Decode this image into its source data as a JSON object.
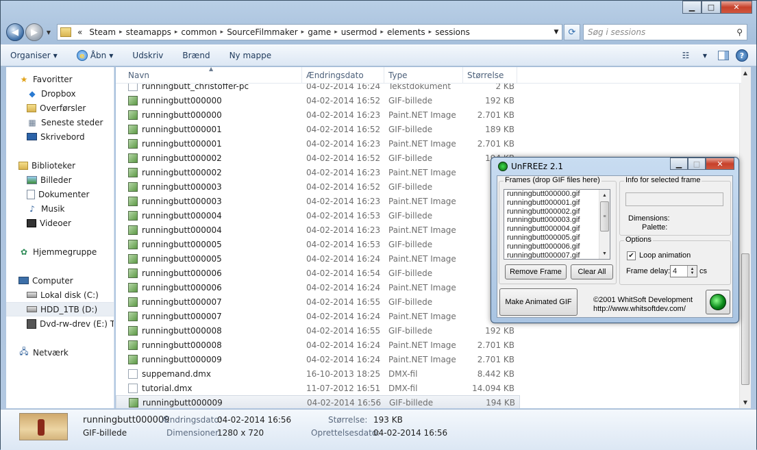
{
  "addressbar": {
    "overflow": "«",
    "crumbs": [
      "Steam",
      "steamapps",
      "common",
      "SourceFilmmaker",
      "game",
      "usermod",
      "elements",
      "sessions"
    ],
    "search_placeholder": "Søg i sessions"
  },
  "toolbar": {
    "organize": "Organiser",
    "open": "Åbn",
    "print": "Udskriv",
    "burn": "Brænd",
    "new_folder": "Ny mappe"
  },
  "sidebar": {
    "favorites": "Favoritter",
    "dropbox": "Dropbox",
    "downloads": "Overførsler",
    "recent": "Seneste steder",
    "desktop": "Skrivebord",
    "libraries": "Biblioteker",
    "pictures": "Billeder",
    "documents": "Dokumenter",
    "music": "Musik",
    "videos": "Videoer",
    "homegroup": "Hjemmegruppe",
    "computer": "Computer",
    "disk_c": "Lokal disk (C:)",
    "disk_d": "HDD_1TB (D:)",
    "disk_e": "Dvd-rw-drev (E:) The",
    "network": "Netværk"
  },
  "columns": {
    "name": "Navn",
    "date": "Ændringsdato",
    "type": "Type",
    "size": "Størrelse"
  },
  "files": [
    {
      "name": "runningbutt_christoffer-pc",
      "date": "04-02-2014 16:24",
      "type": "Tekstdokument",
      "size": "2 KB",
      "icon": "doc"
    },
    {
      "name": "runningbutt000000",
      "date": "04-02-2014 16:52",
      "type": "GIF-billede",
      "size": "192 KB",
      "icon": "gif"
    },
    {
      "name": "runningbutt000000",
      "date": "04-02-2014 16:23",
      "type": "Paint.NET Image",
      "size": "2.701 KB",
      "icon": "gif"
    },
    {
      "name": "runningbutt000001",
      "date": "04-02-2014 16:52",
      "type": "GIF-billede",
      "size": "189 KB",
      "icon": "gif"
    },
    {
      "name": "runningbutt000001",
      "date": "04-02-2014 16:23",
      "type": "Paint.NET Image",
      "size": "2.701 KB",
      "icon": "gif"
    },
    {
      "name": "runningbutt000002",
      "date": "04-02-2014 16:52",
      "type": "GIF-billede",
      "size": "194 KB",
      "icon": "gif"
    },
    {
      "name": "runningbutt000002",
      "date": "04-02-2014 16:23",
      "type": "Paint.NET Image",
      "size": "",
      "icon": "gif"
    },
    {
      "name": "runningbutt000003",
      "date": "04-02-2014 16:52",
      "type": "GIF-billede",
      "size": "",
      "icon": "gif"
    },
    {
      "name": "runningbutt000003",
      "date": "04-02-2014 16:23",
      "type": "Paint.NET Image",
      "size": "",
      "icon": "gif"
    },
    {
      "name": "runningbutt000004",
      "date": "04-02-2014 16:53",
      "type": "GIF-billede",
      "size": "",
      "icon": "gif"
    },
    {
      "name": "runningbutt000004",
      "date": "04-02-2014 16:23",
      "type": "Paint.NET Image",
      "size": "",
      "icon": "gif"
    },
    {
      "name": "runningbutt000005",
      "date": "04-02-2014 16:53",
      "type": "GIF-billede",
      "size": "",
      "icon": "gif"
    },
    {
      "name": "runningbutt000005",
      "date": "04-02-2014 16:24",
      "type": "Paint.NET Image",
      "size": "",
      "icon": "gif"
    },
    {
      "name": "runningbutt000006",
      "date": "04-02-2014 16:54",
      "type": "GIF-billede",
      "size": "",
      "icon": "gif"
    },
    {
      "name": "runningbutt000006",
      "date": "04-02-2014 16:24",
      "type": "Paint.NET Image",
      "size": "",
      "icon": "gif"
    },
    {
      "name": "runningbutt000007",
      "date": "04-02-2014 16:55",
      "type": "GIF-billede",
      "size": "",
      "icon": "gif"
    },
    {
      "name": "runningbutt000007",
      "date": "04-02-2014 16:24",
      "type": "Paint.NET Image",
      "size": "",
      "icon": "gif"
    },
    {
      "name": "runningbutt000008",
      "date": "04-02-2014 16:55",
      "type": "GIF-billede",
      "size": "192 KB",
      "icon": "gif"
    },
    {
      "name": "runningbutt000008",
      "date": "04-02-2014 16:24",
      "type": "Paint.NET Image",
      "size": "2.701 KB",
      "icon": "gif"
    },
    {
      "name": "runningbutt000009",
      "date": "04-02-2014 16:24",
      "type": "Paint.NET Image",
      "size": "2.701 KB",
      "icon": "gif"
    },
    {
      "name": "suppemand.dmx",
      "date": "16-10-2013 18:25",
      "type": "DMX-fil",
      "size": "8.442 KB",
      "icon": "doc"
    },
    {
      "name": "tutorial.dmx",
      "date": "11-07-2012 16:51",
      "type": "DMX-fil",
      "size": "14.094 KB",
      "icon": "doc"
    },
    {
      "name": "runningbutt000009",
      "date": "04-02-2014 16:56",
      "type": "GIF-billede",
      "size": "194 KB",
      "icon": "gif"
    }
  ],
  "selected_index": 22,
  "details": {
    "name": "runningbutt000009",
    "type": "GIF-billede",
    "modified_label": "Ændringsdato:",
    "modified": "04-02-2014 16:56",
    "dimensions_label": "Dimensioner:",
    "dimensions": "1280 x 720",
    "size_label": "Størrelse:",
    "size": "193 KB",
    "created_label": "Oprettelsesdato:",
    "created": "04-02-2014 16:56"
  },
  "unfreez": {
    "title": "UnFREEz 2.1",
    "frames_group": "Frames (drop GIF files here)",
    "frames": [
      "runningbutt000000.gif",
      "runningbutt000001.gif",
      "runningbutt000002.gif",
      "runningbutt000003.gif",
      "runningbutt000004.gif",
      "runningbutt000005.gif",
      "runningbutt000006.gif",
      "runningbutt000007.gif"
    ],
    "remove_frame": "Remove Frame",
    "clear_all": "Clear All",
    "info_group": "Info for selected frame",
    "dimensions": "Dimensions:",
    "palette": "Palette:",
    "options_group": "Options",
    "loop_animation": "Loop animation",
    "loop_checked": true,
    "frame_delay_label": "Frame delay:",
    "frame_delay": "4",
    "frame_delay_unit": "cs",
    "make_gif": "Make Animated GIF",
    "copyright": "©2001 WhitSoft Development",
    "url": "http://www.whitsoftdev.com/"
  }
}
